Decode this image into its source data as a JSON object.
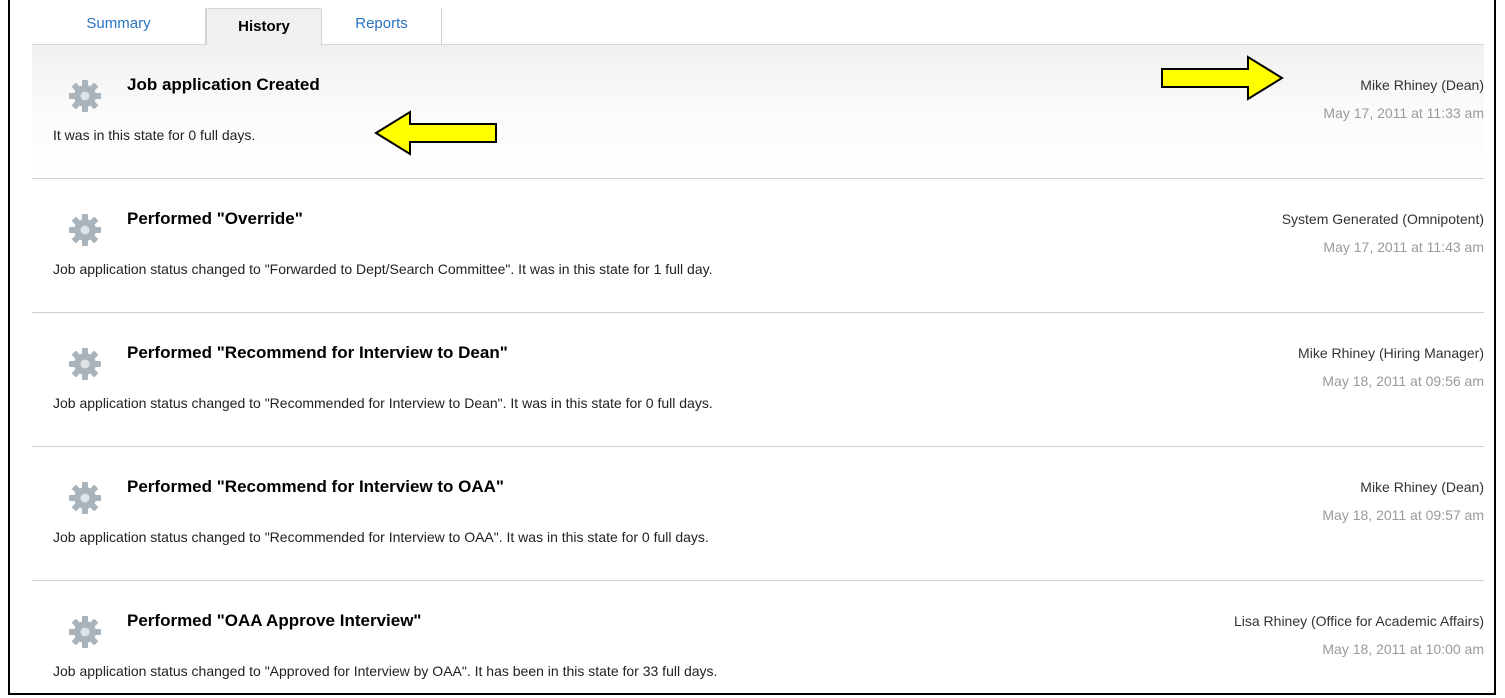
{
  "tabs": {
    "summary": "Summary",
    "history": "History",
    "reports": "Reports"
  },
  "entries": [
    {
      "title": "Job application Created",
      "description": "It was in this state for 0 full days.",
      "actor": "Mike Rhiney (Dean)",
      "timestamp": "May 17, 2011 at 11:33 am"
    },
    {
      "title": "Performed \"Override\"",
      "description": "Job application status changed to \"Forwarded to Dept/Search Committee\". It was in this state for 1 full day.",
      "actor": "System Generated (Omnipotent)",
      "timestamp": "May 17, 2011 at 11:43 am"
    },
    {
      "title": "Performed \"Recommend for Interview to Dean\"",
      "description": "Job application status changed to \"Recommended for Interview to Dean\". It was in this state for 0 full days.",
      "actor": "Mike Rhiney (Hiring Manager)",
      "timestamp": "May 18, 2011 at 09:56 am"
    },
    {
      "title": "Performed \"Recommend for Interview to OAA\"",
      "description": "Job application status changed to \"Recommended for Interview to OAA\". It was in this state for 0 full days.",
      "actor": "Mike Rhiney (Dean)",
      "timestamp": "May 18, 2011 at 09:57 am"
    },
    {
      "title": "Performed \"OAA Approve Interview\"",
      "description": "Job application status changed to \"Approved for Interview by OAA\". It has been in this state for 33 full days.",
      "actor": "Lisa Rhiney (Office for Academic Affairs)",
      "timestamp": "May 18, 2011 at 10:00 am"
    }
  ],
  "icons": {
    "entry_icon": "gear-icon",
    "annotation": "yellow-arrow-icon"
  },
  "colors": {
    "tab_link": "#2a73c0",
    "annotation_fill": "#ffff00",
    "timestamp": "#9a9a9a"
  }
}
